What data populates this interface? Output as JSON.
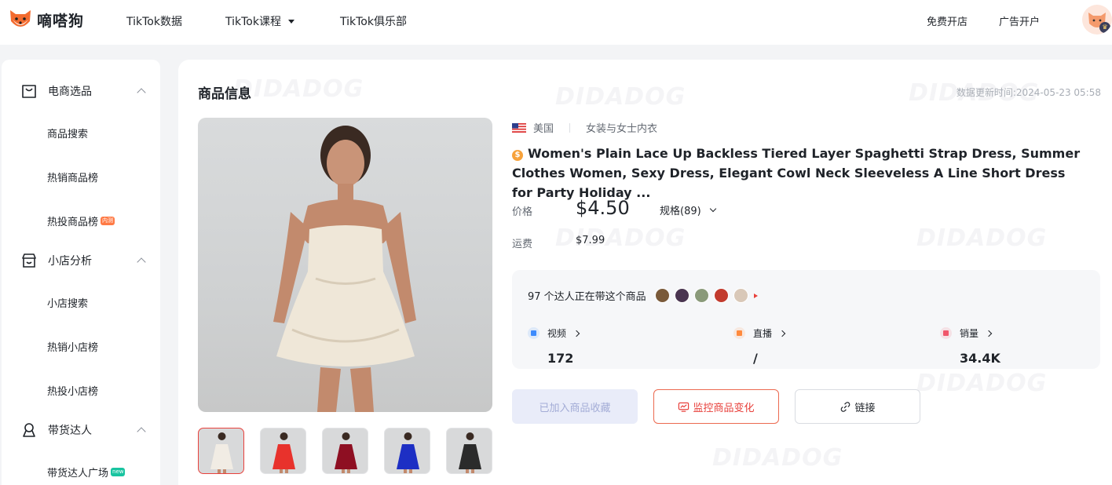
{
  "header": {
    "brand": "嘀嗒狗",
    "nav": [
      {
        "label": "TikTok数据"
      },
      {
        "label": "TikTok课程"
      },
      {
        "label": "TikTok俱乐部"
      }
    ],
    "right": {
      "open_store": "免费开店",
      "ad_account": "广告开户"
    }
  },
  "sidebar": {
    "sections": [
      {
        "label": "电商选品",
        "items": [
          {
            "label": "商品搜索"
          },
          {
            "label": "热销商品榜"
          },
          {
            "label": "热投商品榜",
            "badge": "内测"
          }
        ]
      },
      {
        "label": "小店分析",
        "items": [
          {
            "label": "小店搜索"
          },
          {
            "label": "热销小店榜"
          },
          {
            "label": "热投小店榜"
          }
        ]
      },
      {
        "label": "带货达人",
        "items": [
          {
            "label": "带货达人广场",
            "badge": "new"
          }
        ]
      }
    ]
  },
  "main": {
    "title": "商品信息",
    "update_time": "数据更新时间:2024-05-23 05:58",
    "watermark": "DIDADOG",
    "country": "美国",
    "category": "女装与女士内衣",
    "product_title": "Women's Plain Lace Up Backless Tiered Layer Spaghetti Strap Dress, Summer Clothes Women, Sexy Dress, Elegant Cowl Neck Sleeveless A Line Short Dress for Party Holiday ...",
    "price_label": "价格",
    "price": "$4.50",
    "spec": "规格(89)",
    "shipping_label": "运费",
    "shipping": "$7.99",
    "creators_text": "97 个达人正在带这个商品",
    "stats": [
      {
        "label": "视频",
        "value": "172",
        "color": "#3d8bfd"
      },
      {
        "label": "直播",
        "value": "/",
        "color": "#ff8a3d"
      },
      {
        "label": "销量",
        "value": "34.4K",
        "color": "#f0566b"
      }
    ],
    "buttons": {
      "favorite": "已加入商品收藏",
      "monitor": "监控商品变化",
      "link": "链接"
    },
    "thumb_colors": [
      "#f1ece4",
      "#e8322c",
      "#8e0f22",
      "#1d2fc4",
      "#2b2b2b"
    ]
  }
}
